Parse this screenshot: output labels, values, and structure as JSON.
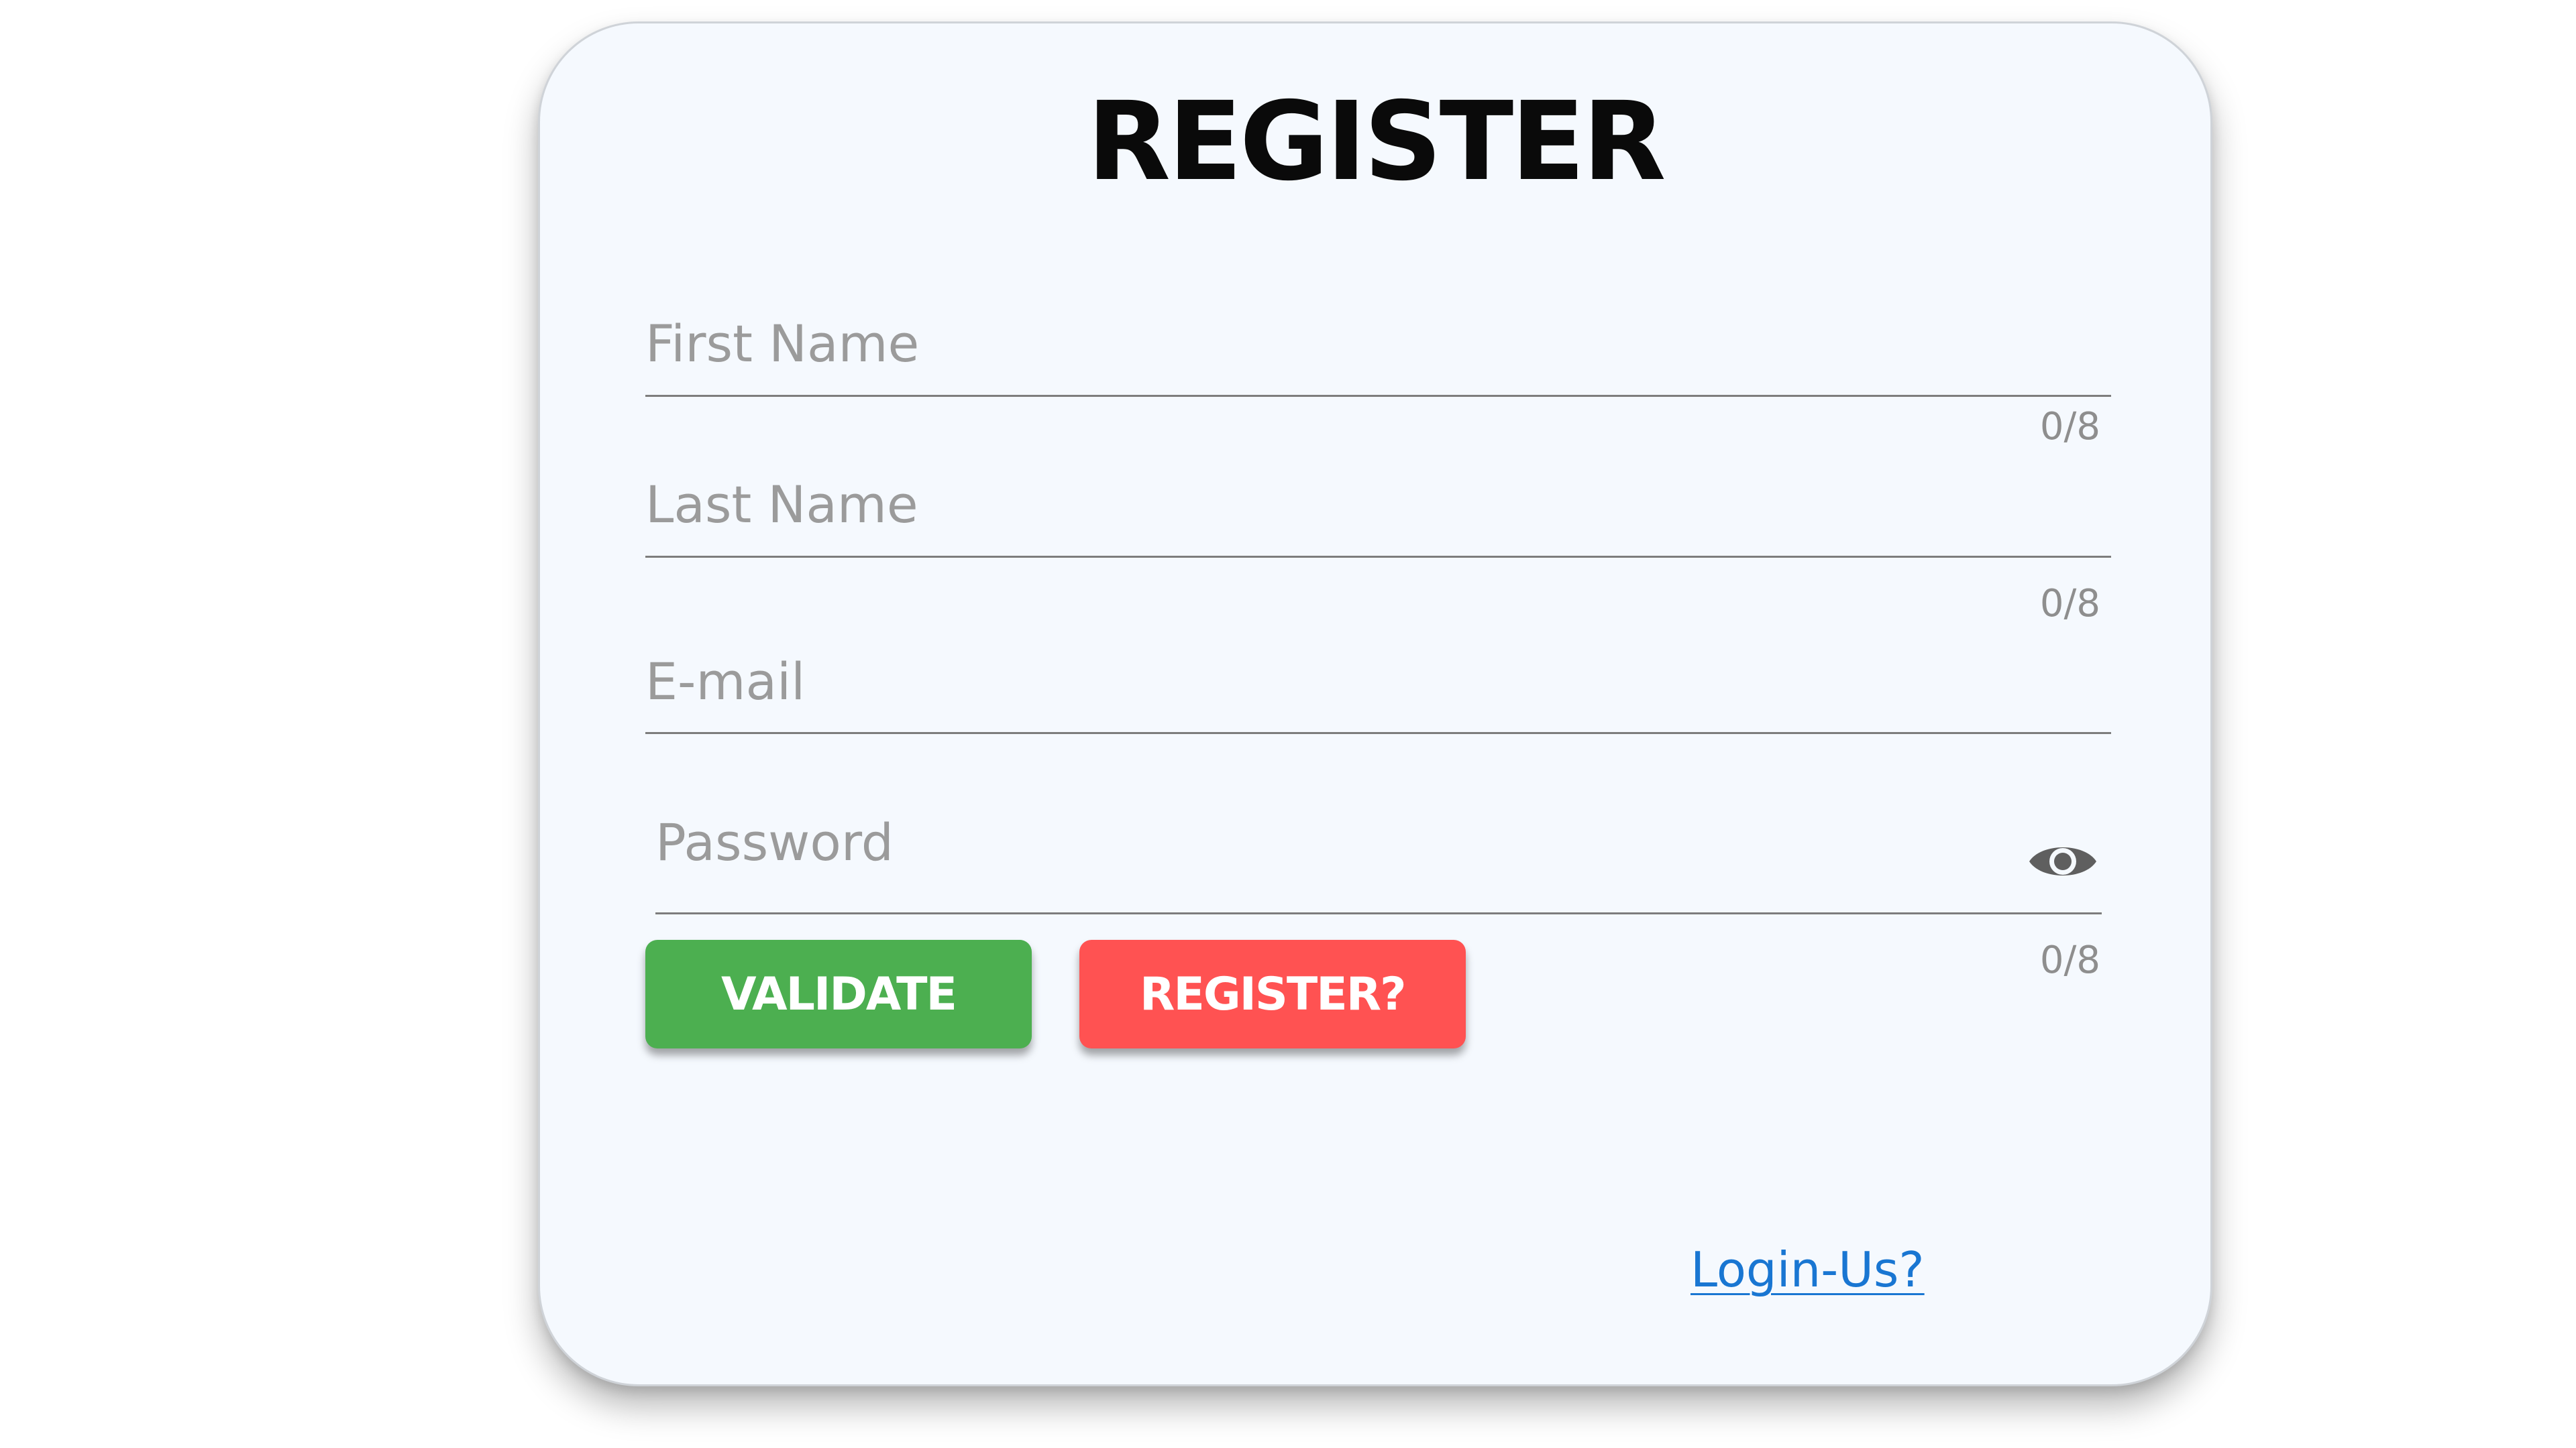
{
  "form": {
    "title": "REGISTER",
    "fields": [
      {
        "placeholder": "First Name",
        "counter": "0/8"
      },
      {
        "placeholder": "Last Name",
        "counter": "0/8"
      },
      {
        "placeholder": "E-mail"
      },
      {
        "placeholder": "Password",
        "counter": "0/8",
        "icon": "eye-icon"
      }
    ],
    "buttons": {
      "validate": "VALIDATE",
      "register": "REGISTER?"
    },
    "login_link": "Login-Us?"
  },
  "colors": {
    "card_background": "#f5f9fe",
    "validate_button": "#4caf50",
    "register_button": "#ff5252",
    "link": "#1976d2",
    "placeholder_text": "#9b9b9b"
  }
}
